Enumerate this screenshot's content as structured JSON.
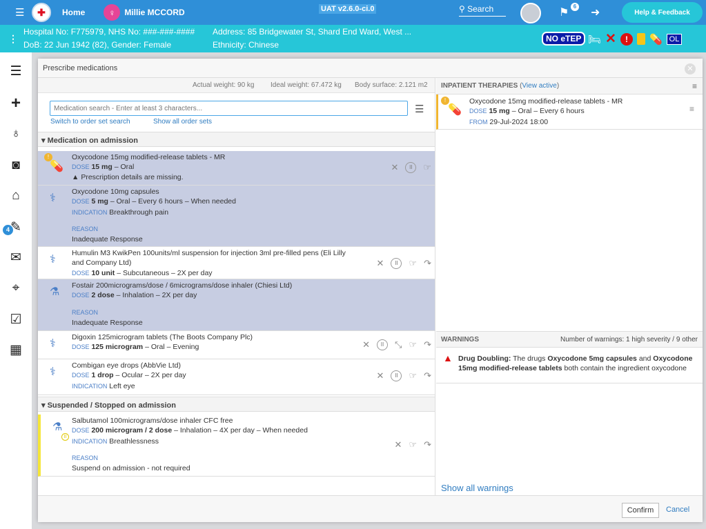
{
  "topbar": {
    "home_label": "Home",
    "patient_name": "Millie MCCORD",
    "version": "UAT v2.6.0-ci.0",
    "search_label": "Search",
    "flag_count": "6",
    "help_label": "Help & Feedback",
    "icons": {
      "menu": "hamburger-icon",
      "search": "search-icon",
      "flag": "flag-icon",
      "logout": "logout-icon"
    }
  },
  "banner": {
    "hospital": "Hospital No: F775979, NHS No: ###-###-####",
    "dob": "DoB: 22 Jun 1942 (82), Gender: Female",
    "address": "Address: 85 Bridgewater St, Shard End Ward, West ...",
    "ethnicity": "Ethnicity: Chinese",
    "no_etep": "NO eTEP",
    "ol": "OL"
  },
  "sidebar": {
    "badge": "4"
  },
  "modal": {
    "title": "Prescribe medications",
    "actual_weight": "Actual weight: 90 kg",
    "ideal_weight": "Ideal weight: 67.472 kg",
    "body_surface": "Body surface: 2.121 m2",
    "search_placeholder": "Medication search - Enter at least 3 characters...",
    "switch_link": "Switch to order set search",
    "show_all_sets": "Show all order sets",
    "section_admission": "Medication on admission",
    "section_suspended": "Suspended / Stopped on admission",
    "rows": [
      {
        "name": "Oxycodone 15mg modified-release tablets - MR",
        "dose_label": "DOSE",
        "dose": "15 mg",
        "route": "– Oral",
        "warning": "Prescription details are missing."
      },
      {
        "name": "Oxycodone 10mg capsules",
        "dose_label": "DOSE",
        "dose": "5 mg",
        "route": "– Oral – Every 6 hours – When needed",
        "ind_label": "INDICATION",
        "indication": "Breakthrough pain",
        "reason_label": "REASON",
        "reason": "Inadequate Response"
      },
      {
        "name": "Humulin M3 KwikPen 100units/ml suspension for injection 3ml pre-filled pens (Eli Lilly and Company Ltd)",
        "dose_label": "DOSE",
        "dose": "10 unit",
        "route": "– Subcutaneous – 2X per day"
      },
      {
        "name": "Fostair 200micrograms/dose / 6micrograms/dose inhaler (Chiesi Ltd)",
        "dose_label": "DOSE",
        "dose": "2 dose",
        "route": "– Inhalation – 2X per day",
        "reason_label": "REASON",
        "reason": "Inadequate Response"
      },
      {
        "name": "Digoxin 125microgram tablets (The Boots Company Plc)",
        "dose_label": "DOSE",
        "dose": "125 microgram",
        "route": "– Oral – Evening"
      },
      {
        "name": "Combigan eye drops (AbbVie Ltd)",
        "dose_label": "DOSE",
        "dose": "1 drop",
        "route": "– Ocular – 2X per day",
        "ind_label": "INDICATION",
        "indication": "Left eye"
      },
      {
        "name": "Salbutamol 100micrograms/dose inhaler CFC free",
        "dose_label": "DOSE",
        "dose": "200 microgram / 2 dose",
        "route": "– Inhalation – 4X per day – When needed",
        "ind_label": "INDICATION",
        "indication": "Breathlessness",
        "reason_label": "REASON",
        "reason": "Suspend on admission - not required"
      }
    ],
    "inpatient": {
      "header": "INPATIENT THERAPIES",
      "view_active": "View active",
      "name": "Oxycodone 15mg modified-release tablets - MR",
      "dose_label": "DOSE",
      "dose": "15 mg",
      "route": "– Oral – Every 6 hours",
      "from_label": "FROM",
      "from": "29-Jul-2024 18:00"
    },
    "warnings": {
      "header": "WARNINGS",
      "count": "Number of warnings: 1 high severity / 9 other",
      "title": "Drug Doubling:",
      "text1": "The drugs",
      "drug1": "Oxycodone 5mg capsules",
      "text2": "and",
      "drug2": "Oxycodone 15mg modified-release tablets",
      "text3": "both contain the ingredient oxycodone",
      "show_all": "Show all warnings"
    },
    "confirm": "Confirm",
    "cancel": "Cancel"
  }
}
